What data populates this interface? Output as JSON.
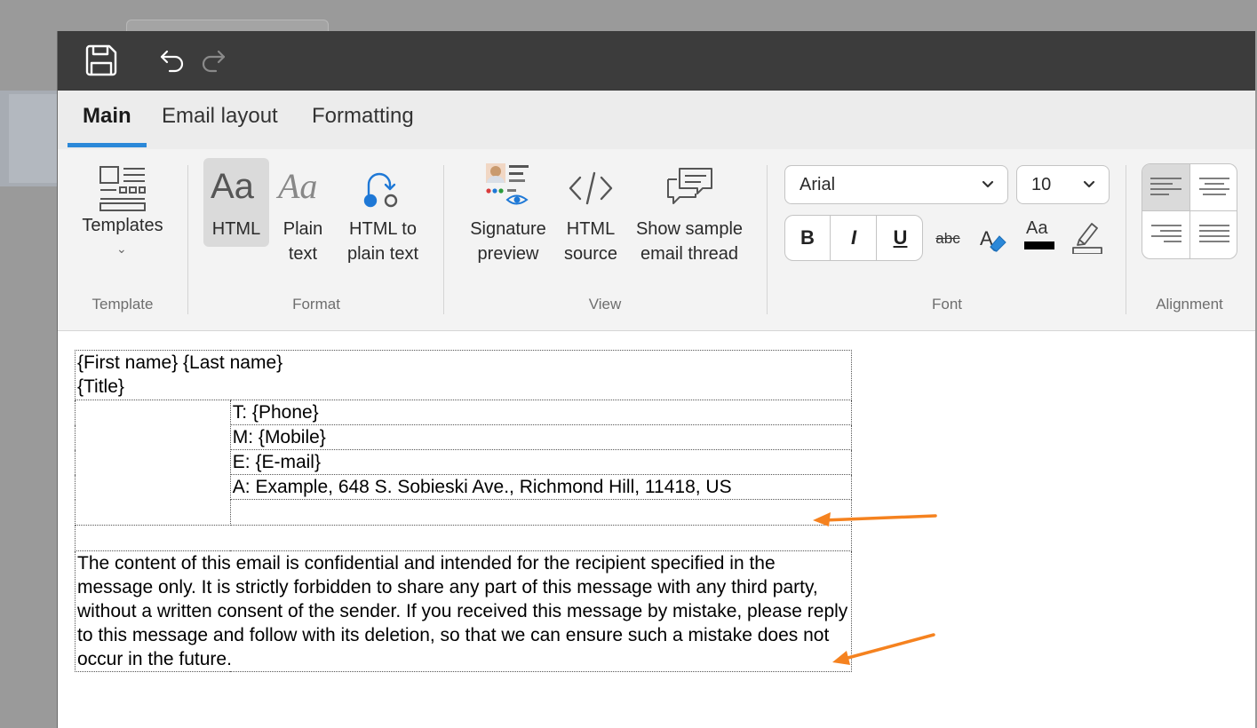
{
  "toolbar": {
    "save_icon": "save-icon",
    "undo_icon": "undo-icon",
    "redo_icon": "redo-icon"
  },
  "tabs": [
    {
      "label": "Main",
      "active": true
    },
    {
      "label": "Email layout",
      "active": false
    },
    {
      "label": "Formatting",
      "active": false
    }
  ],
  "ribbon": {
    "template_group": {
      "label": "Template",
      "templates_button": "Templates"
    },
    "format_group": {
      "label": "Format",
      "html_button": "HTML",
      "plain_text_line1": "Plain",
      "plain_text_line2": "text",
      "html_to_plain_line1": "HTML to",
      "html_to_plain_line2": "plain text",
      "icon_glyph": "Aa"
    },
    "view_group": {
      "label": "View",
      "signature_preview_line1": "Signature",
      "signature_preview_line2": "preview",
      "html_source_line1": "HTML",
      "html_source_line2": "source",
      "sample_thread_line1": "Show sample",
      "sample_thread_line2": "email thread"
    },
    "font_group": {
      "label": "Font",
      "font_family": "Arial",
      "font_size": "10",
      "bold": "B",
      "italic": "I",
      "underline": "U",
      "strikethrough": "abc",
      "font_color_glyph": "Aa"
    },
    "alignment_group": {
      "label": "Alignment"
    }
  },
  "signature": {
    "name_line": "{First name} {Last name}",
    "title_line": "{Title}",
    "phone": "T: {Phone}",
    "mobile": "M: {Mobile}",
    "email": "E: {E-mail}",
    "address": "A: Example, 648 S. Sobieski Ave., Richmond Hill, 11418, US",
    "disclaimer": "The content of this email is confidential and intended for the recipient specified in the message only. It is strictly forbidden to share any part of this message with any third party, without a written consent of the sender. If you received this message by mistake, please reply to this message and follow with its deletion, so that we can ensure such a mistake does not occur in the future."
  },
  "colors": {
    "accent": "#2b88d8",
    "arrow": "#f5821f",
    "titlebar": "#3c3c3c"
  }
}
